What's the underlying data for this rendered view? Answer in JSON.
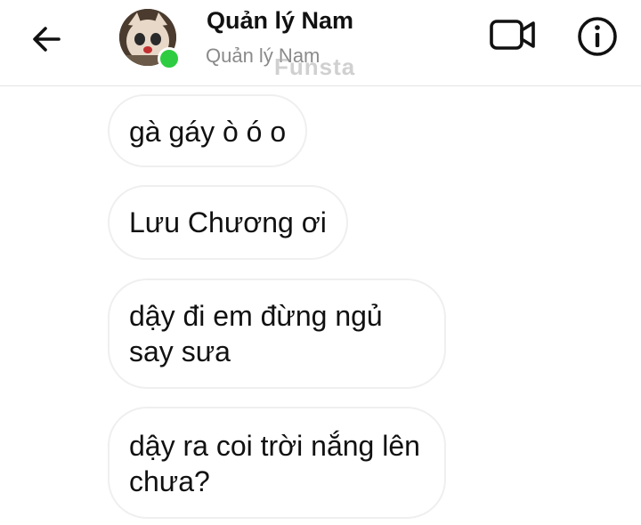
{
  "header": {
    "contact_name": "Quản lý Nam",
    "status_text": "Quản lý Nam",
    "watermark": "Funsta",
    "online_color": "#2ecc40",
    "icons": {
      "back": "arrow-left-icon",
      "video": "video-camera-icon",
      "info": "info-circle-icon"
    }
  },
  "messages": [
    {
      "text": "gà gáy ò ó o"
    },
    {
      "text": "Lưu Chương ơi"
    },
    {
      "text": "dậy đi em đừng ngủ say sưa"
    },
    {
      "text": "dậy ra coi trời nắng lên chưa?"
    }
  ]
}
